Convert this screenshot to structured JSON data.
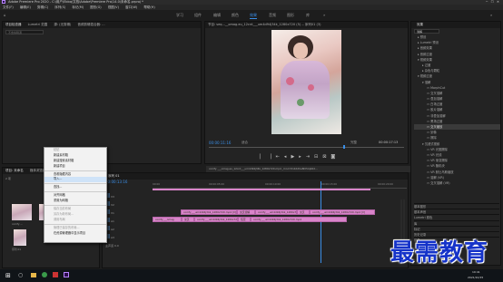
{
  "window": {
    "title": "Adobe Premiere Pro 2020 - C:\\用户\\Ebbq\\文档\\Adobe\\Premiere Pro\\14.0\\未命名.prproj *"
  },
  "menu": [
    "文件(F)",
    "编辑(E)",
    "剪辑(C)",
    "序列(S)",
    "标记(M)",
    "图形(G)",
    "视图(V)",
    "窗口(W)",
    "帮助(H)"
  ],
  "workspaces": [
    "学习",
    "组件",
    "编辑",
    "颜色",
    "效果",
    "音频",
    "图形",
    "库"
  ],
  "workspaces_more": "»",
  "source_panel": {
    "tabs": [
      "项目检查器",
      "Lumetri 范围",
      "源: (无剪辑)",
      "音频剪辑混合器: ..."
    ],
    "search_placeholder": "不含剪辑源"
  },
  "program_panel": {
    "title": "节目: seq...__omag.eu_12cnt___um4d94j34k_1280x720 (5) -- 序列01 (3)",
    "timecode_left": "00:00:11:16",
    "fit": "适合",
    "quality": "完整",
    "timecode_right": "00:00:17:13",
    "file_strip": "comfy ___omag.eu_12cnt___um4d94j34k_1280x720.mp4 _mr.m3m4Xdhe8hHzq94d..."
  },
  "project_panel": {
    "tabs": [
      "项目: 未命名",
      "媒体浏览器",
      "库",
      "信息"
    ],
    "item_count": "2 项",
    "thumb_labels": [
      "comfy ...",
      "序列 01"
    ]
  },
  "timeline": {
    "tab": "序列 01",
    "timecode": "00:00:13:16",
    "ruler": [
      "00:00",
      "00:00:05:00",
      "00:00:10:00",
      "00:00:15:00",
      "00:00:20:00"
    ],
    "tracks": [
      "V3",
      "V2",
      "V1",
      "A1",
      "A2",
      "A3"
    ],
    "clips_v1": [
      "comfy___um4d94j34k_1280x720.mp4 [V]",
      "交叉溶解",
      "comfy___um4d94j34k_1280x720 [V]",
      "交叉",
      "comfy___um4d94j34k_1280x720.mp4 [V]"
    ],
    "clips_a1": [
      "comfy___omag",
      "交叉",
      "comfy___um4d94j34k_1280x720.mp4",
      "恒定",
      "comfy___um4d94j34k_1280x720.mp4"
    ],
    "master": "主声道",
    "master_val": "0.0"
  },
  "effects_panel": {
    "title": "效果",
    "search": "溶解",
    "items": [
      "预设",
      "Lumetri 预设",
      "音频效果",
      "音频过渡",
      "视频效果",
      "过渡",
      "杂色与颗粒",
      "视频过渡",
      "溶解",
      "MorphCut",
      "交叉溶解",
      "叠加溶解",
      "白场过渡",
      "胶片溶解",
      "非叠加溶解",
      "黑场过渡",
      "交叉缩放",
      "划像",
      "擦除",
      "沉浸式视频",
      "VR 光圈擦除",
      "VR 光线",
      "VR 渐变擦除",
      "VR 随机块",
      "VR 默比乌斯缩放",
      "溶解 (VR)",
      "交叉溶解 (VR)"
    ],
    "bottom": [
      "基本图形",
      "基本声音",
      "Lumetri 颜色",
      "库",
      "标记",
      "历史记录",
      "信息"
    ]
  },
  "context_menu": {
    "items": [
      {
        "label": "粘贴",
        "state": "disabled"
      },
      {
        "label": "新建素材箱",
        "state": "normal"
      },
      {
        "label": "新建搜索素材箱",
        "state": "normal"
      },
      {
        "label": "新建项目",
        "state": "normal"
      },
      {
        "label": "sep"
      },
      {
        "label": "查看隐藏内容",
        "state": "normal"
      },
      {
        "label": "导入...",
        "state": "selected"
      },
      {
        "label": "sep"
      },
      {
        "label": "查找...",
        "state": "normal"
      },
      {
        "label": "sep"
      },
      {
        "label": "对齐网格",
        "state": "normal"
      },
      {
        "label": "重置为网格",
        "state": "normal"
      },
      {
        "label": "sep"
      },
      {
        "label": "保存当前布局",
        "state": "disabled"
      },
      {
        "label": "另存为新布局...",
        "state": "disabled"
      },
      {
        "label": "调用布局",
        "state": "disabled"
      },
      {
        "label": "sep"
      },
      {
        "label": "管理已保存的布局...",
        "state": "disabled"
      },
      {
        "label": "在资源管理器中显示项目",
        "state": "normal"
      }
    ]
  },
  "watermark": "最需教育",
  "taskbar": {
    "clock": "19:41",
    "date": "2021/10/15"
  },
  "colors": {
    "accent": "#3a8ee6",
    "clip_pink": "#d884c9",
    "timecode": "#3a8ee6",
    "bg": "#1d1d1d"
  }
}
